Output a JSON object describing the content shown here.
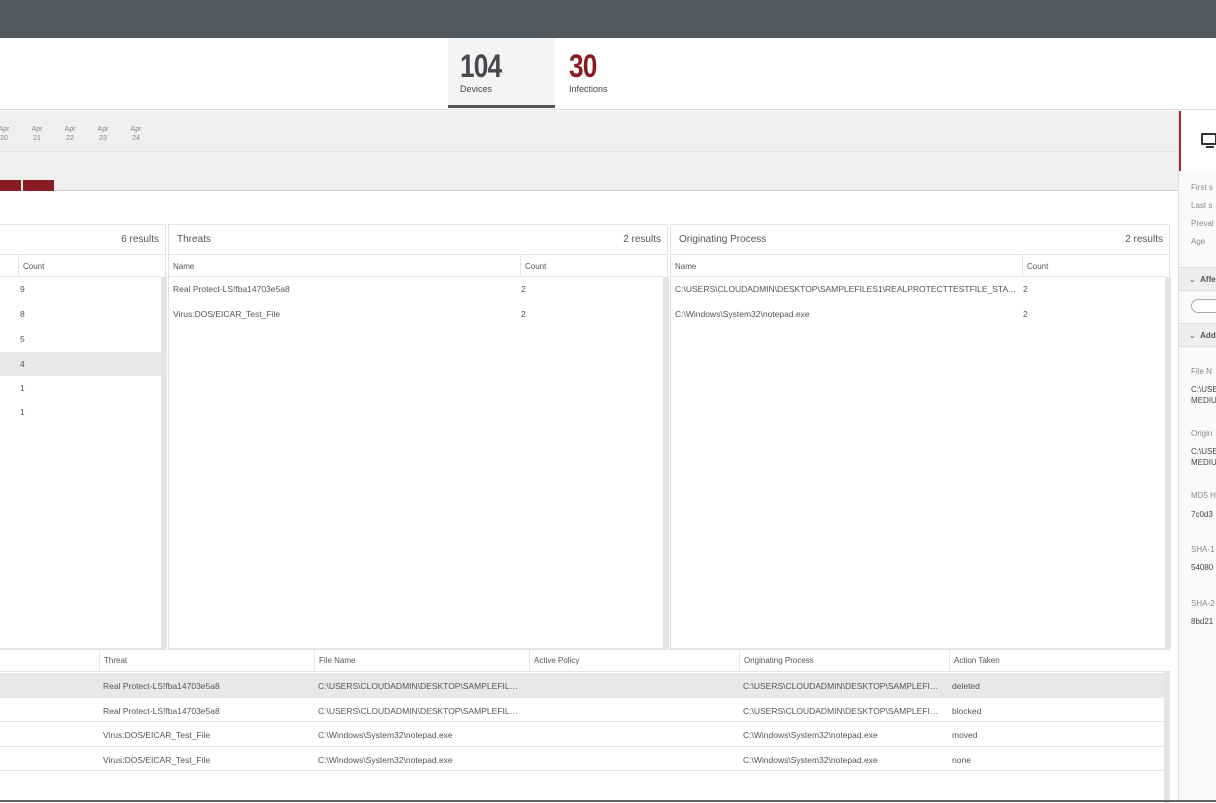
{
  "kpis": {
    "devices": {
      "value": "104",
      "label": "Devices"
    },
    "infections": {
      "value": "30",
      "label": "Infections"
    }
  },
  "timeline": {
    "dates": [
      {
        "mon": "Apr",
        "day": "20"
      },
      {
        "mon": "Apr",
        "day": "21"
      },
      {
        "mon": "Apr",
        "day": "22"
      },
      {
        "mon": "Apr",
        "day": "23"
      },
      {
        "mon": "Apr",
        "day": "24"
      }
    ]
  },
  "panels": {
    "left": {
      "results": "6 results",
      "col_count": "Count",
      "counts": [
        "9",
        "8",
        "5",
        "4",
        "1",
        "1"
      ]
    },
    "threats": {
      "title": "Threats",
      "results": "2 results",
      "col_name": "Name",
      "col_count": "Count",
      "rows": [
        {
          "name": "Real Protect-LS!fba14703e5a8",
          "count": "2"
        },
        {
          "name": "Virus:DOS/EICAR_Test_File",
          "count": "2"
        }
      ]
    },
    "process": {
      "title": "Originating Process",
      "results": "2 results",
      "col_name": "Name",
      "col_count": "Count",
      "rows": [
        {
          "name": "C:\\USERS\\CLOUDADMIN\\DESKTOP\\SAMPLEFILES1\\REALPROTECTTESTFILE_STATIC_...",
          "count": "2"
        },
        {
          "name": "C:\\Windows\\System32\\notepad.exe",
          "count": "2"
        }
      ]
    }
  },
  "detections": {
    "columns": [
      "Threat",
      "File Name",
      "Active Policy",
      "Originating Process",
      "Action Taken"
    ],
    "rows": [
      {
        "threat": "Real Protect-LS!fba14703e5a8",
        "file": "C:\\USERS\\CLOUDADMIN\\DESKTOP\\SAMPLEFILES...",
        "policy": "",
        "process": "C:\\USERS\\CLOUDADMIN\\DESKTOP\\SAMPLEFILE...",
        "action": "deleted"
      },
      {
        "threat": "Real Protect-LS!fba14703e5a8",
        "file": "C:\\USERS\\CLOUDADMIN\\DESKTOP\\SAMPLEFILES...",
        "policy": "",
        "process": "C:\\USERS\\CLOUDADMIN\\DESKTOP\\SAMPLEFILE...",
        "action": "blocked"
      },
      {
        "threat": "Virus:DOS/EICAR_Test_File",
        "file": "C:\\Windows\\System32\\notepad.exe",
        "policy": "",
        "process": "C:\\Windows\\System32\\notepad.exe",
        "action": "moved"
      },
      {
        "threat": "Virus:DOS/EICAR_Test_File",
        "file": "C:\\Windows\\System32\\notepad.exe",
        "policy": "",
        "process": "C:\\Windows\\System32\\notepad.exe",
        "action": "none"
      }
    ]
  },
  "right_panel": {
    "icon": "monitor-icon",
    "info_labels": [
      "First s",
      "Last s",
      "Preval",
      "Age"
    ],
    "section_affected": "Affe",
    "section_additional": "Add",
    "fields": [
      {
        "label": "File N",
        "value1": "C:\\USE",
        "value2": "MEDIU"
      },
      {
        "label": "Origin",
        "value1": "C:\\USE",
        "value2": "MEDIU"
      },
      {
        "label": "MD5 H",
        "value1": "7c0d3",
        "value2": ""
      },
      {
        "label": "SHA-1",
        "value1": "54080",
        "value2": ""
      },
      {
        "label": "SHA-2",
        "value1": "8bd21",
        "value2": ""
      }
    ]
  }
}
